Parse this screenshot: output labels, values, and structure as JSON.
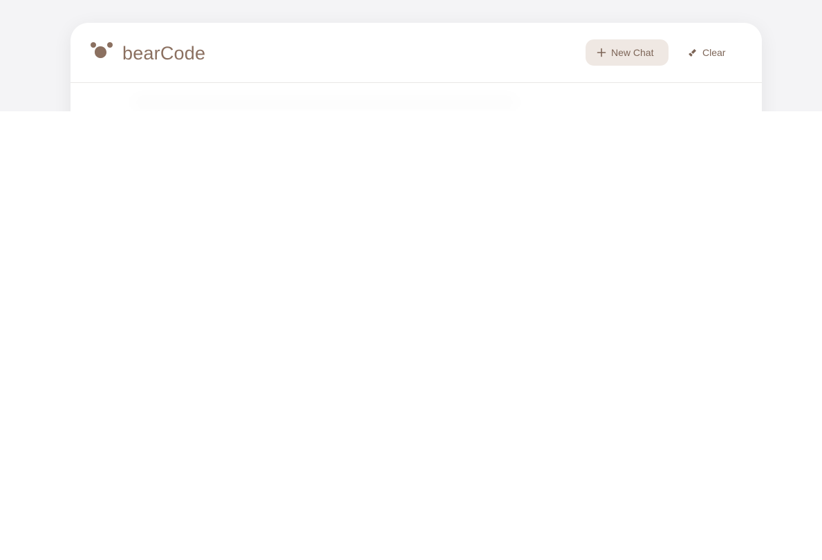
{
  "app": {
    "brand_name": "bearCode",
    "brand_color": "#8b7060"
  },
  "toolbar": {
    "new_chat_label": "New Chat",
    "new_chat_icon": "plus-icon",
    "clear_label": "Clear",
    "clear_icon": "broom-icon"
  }
}
